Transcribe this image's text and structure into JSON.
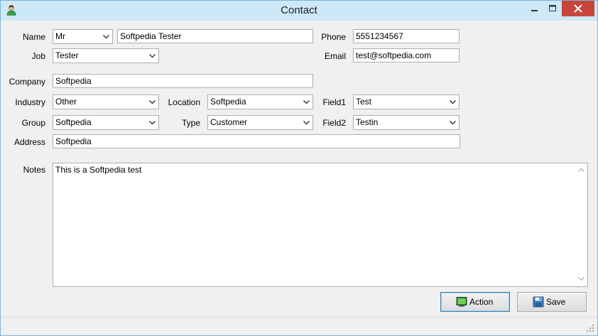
{
  "window": {
    "title": "Contact",
    "minimize_icon": "minimize-icon",
    "maximize_icon": "maximize-icon",
    "close_icon": "close-icon"
  },
  "form": {
    "name": {
      "label": "Name",
      "title_value": "Mr",
      "full_name": "Softpedia Tester"
    },
    "job": {
      "label": "Job",
      "value": "Tester"
    },
    "phone": {
      "label": "Phone",
      "value": "5551234567"
    },
    "email": {
      "label": "Email",
      "value": "test@softpedia.com"
    },
    "company": {
      "label": "Company",
      "value": "Softpedia"
    },
    "industry": {
      "label": "Industry",
      "value": "Other"
    },
    "location": {
      "label": "Location",
      "value": "Softpedia"
    },
    "field1": {
      "label": "Field1",
      "value": "Test"
    },
    "group": {
      "label": "Group",
      "value": "Softpedia"
    },
    "type": {
      "label": "Type",
      "value": "Customer"
    },
    "field2": {
      "label": "Field2",
      "value": "Testin"
    },
    "address": {
      "label": "Address",
      "value": "Softpedia"
    },
    "notes": {
      "label": "Notes",
      "value": "This is a Softpedia test"
    }
  },
  "buttons": {
    "action_label": "Action",
    "save_label": "Save"
  },
  "colors": {
    "titlebar": "#cde8f7",
    "close_button": "#c7463c",
    "window_bg": "#f0f0f0"
  }
}
